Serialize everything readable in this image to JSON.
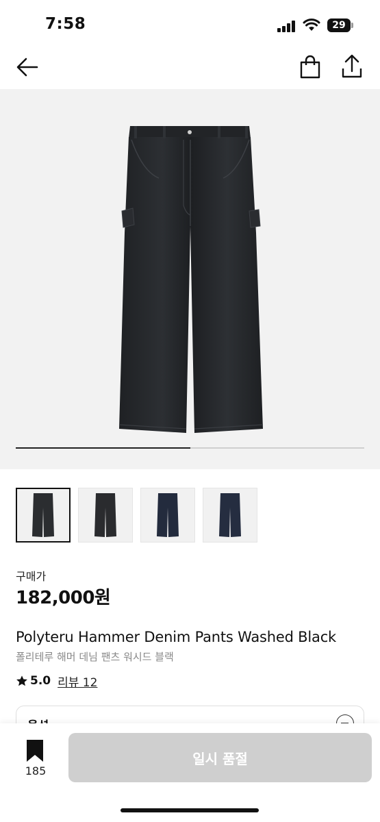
{
  "status_bar": {
    "time": "7:58",
    "battery": "29",
    "icons": [
      "signal-icon",
      "wifi-icon",
      "battery-icon"
    ]
  },
  "nav": {
    "icons": [
      "back-arrow-icon",
      "shopping-bag-icon",
      "share-icon"
    ]
  },
  "gallery": {
    "progress": 0.5,
    "thumbnails": [
      {
        "tone": "washed-black",
        "color": "#2b2d30",
        "selected": true
      },
      {
        "tone": "washed-black-back",
        "color": "#2a2b2e",
        "selected": false
      },
      {
        "tone": "dark-indigo",
        "color": "#232b3d",
        "selected": false
      },
      {
        "tone": "dark-indigo-back",
        "color": "#252d40",
        "selected": false
      }
    ]
  },
  "product": {
    "price_label": "구매가",
    "price": "182,000원",
    "name_en": "Polyteru Hammer Denim Pants Washed Black",
    "name_ko": "폴리테루 해머 데님 팬츠 워시드 블랙",
    "rating": "5.0",
    "review_label": "리뷰 12"
  },
  "options": {
    "label": "옵션"
  },
  "bottom_bar": {
    "bookmark_count": "185",
    "cta_label": "일시 품절",
    "cta_color": "#cfcfcf"
  }
}
